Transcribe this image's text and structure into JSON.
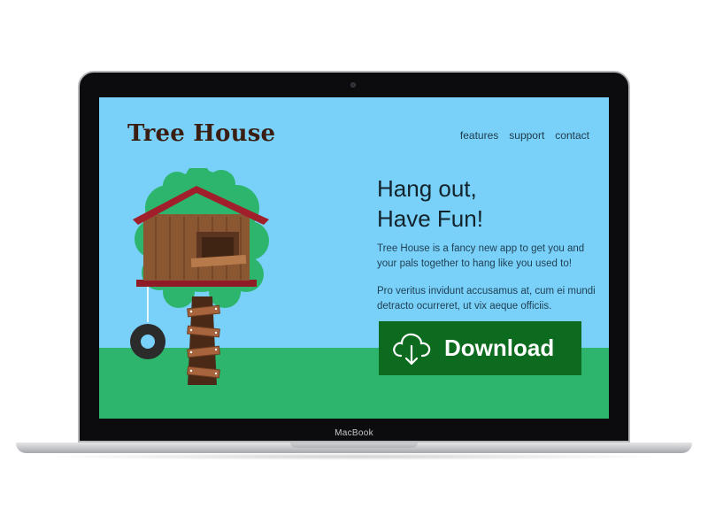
{
  "device": {
    "brand_label": "MacBook"
  },
  "site": {
    "logo_text": "Tree House",
    "nav": [
      {
        "label": "features"
      },
      {
        "label": "support"
      },
      {
        "label": "contact"
      }
    ],
    "hero": {
      "headline_line1": "Hang out,",
      "headline_line2": "Have Fun!",
      "paragraph1": "Tree House is a fancy new app to get you and your pals together to hang like you used to!",
      "paragraph2": "Pro veritus invidunt accusamus at, cum ei mundi detracto ocurreret, ut vix aeque officiis."
    },
    "download_button": {
      "label": "Download",
      "icon": "cloud-download-icon"
    },
    "illustration": {
      "icon": "tree-house-illustration"
    }
  },
  "colors": {
    "sky": "#79d0f8",
    "grass": "#2db56d",
    "button": "#0c6b1e",
    "logo": "#3a1e12"
  }
}
